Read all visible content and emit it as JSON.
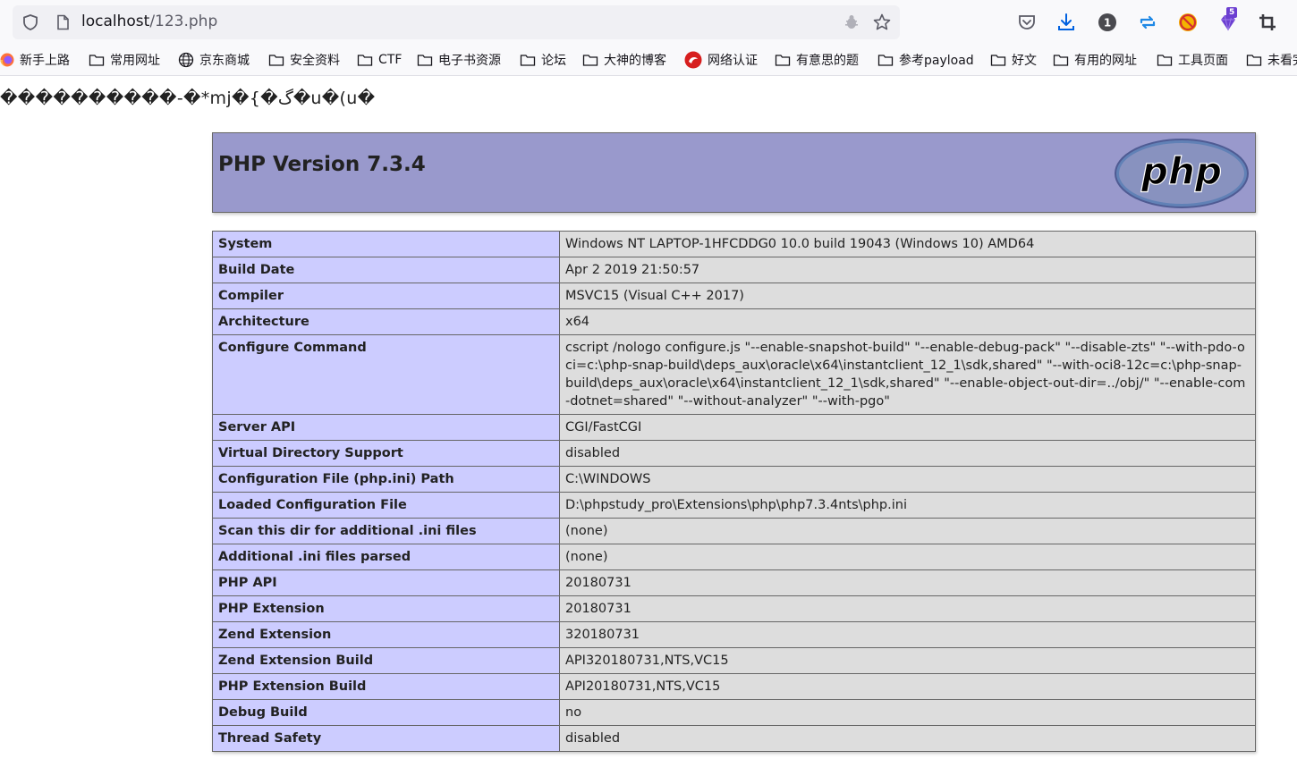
{
  "browser": {
    "url_host": "localhost",
    "url_path": "/123.php",
    "extension_badge": "5",
    "bookmarks": [
      {
        "label": "新手上路",
        "icon": "firefox-icon"
      },
      {
        "label": "常用网址",
        "icon": "folder-icon"
      },
      {
        "label": "京东商城",
        "icon": "globe-icon"
      },
      {
        "label": "安全资料",
        "icon": "folder-icon"
      },
      {
        "label": "CTF",
        "icon": "folder-icon"
      },
      {
        "label": "电子书资源",
        "icon": "folder-icon"
      },
      {
        "label": "论坛",
        "icon": "folder-icon"
      },
      {
        "label": "大神的博客",
        "icon": "folder-icon"
      },
      {
        "label": "网络认证",
        "icon": "red-logo-icon"
      },
      {
        "label": "有意思的题",
        "icon": "folder-icon"
      },
      {
        "label": "参考payload",
        "icon": "folder-icon"
      },
      {
        "label": "好文",
        "icon": "folder-icon"
      },
      {
        "label": "有用的网址",
        "icon": "folder-icon"
      },
      {
        "label": "工具页面",
        "icon": "folder-icon"
      },
      {
        "label": "未看完",
        "icon": "folder-icon"
      }
    ]
  },
  "page": {
    "garbled_text": "����������-�*mj�{�گ�u�(u�",
    "php_version_title": "PHP Version 7.3.4",
    "logo_text": "php",
    "rows": [
      {
        "key": "System",
        "value": "Windows NT LAPTOP-1HFCDDG0 10.0 build 19043 (Windows 10) AMD64"
      },
      {
        "key": "Build Date",
        "value": "Apr 2 2019 21:50:57"
      },
      {
        "key": "Compiler",
        "value": "MSVC15 (Visual C++ 2017)"
      },
      {
        "key": "Architecture",
        "value": "x64"
      },
      {
        "key": "Configure Command",
        "value": "cscript /nologo configure.js \"--enable-snapshot-build\" \"--enable-debug-pack\" \"--disable-zts\" \"--with-pdo-oci=c:\\php-snap-build\\deps_aux\\oracle\\x64\\instantclient_12_1\\sdk,shared\" \"--with-oci8-12c=c:\\php-snap-build\\deps_aux\\oracle\\x64\\instantclient_12_1\\sdk,shared\" \"--enable-object-out-dir=../obj/\" \"--enable-com-dotnet=shared\" \"--without-analyzer\" \"--with-pgo\""
      },
      {
        "key": "Server API",
        "value": "CGI/FastCGI"
      },
      {
        "key": "Virtual Directory Support",
        "value": "disabled"
      },
      {
        "key": "Configuration File (php.ini) Path",
        "value": "C:\\WINDOWS"
      },
      {
        "key": "Loaded Configuration File",
        "value": "D:\\phpstudy_pro\\Extensions\\php\\php7.3.4nts\\php.ini"
      },
      {
        "key": "Scan this dir for additional .ini files",
        "value": "(none)"
      },
      {
        "key": "Additional .ini files parsed",
        "value": "(none)"
      },
      {
        "key": "PHP API",
        "value": "20180731"
      },
      {
        "key": "PHP Extension",
        "value": "20180731"
      },
      {
        "key": "Zend Extension",
        "value": "320180731"
      },
      {
        "key": "Zend Extension Build",
        "value": "API320180731,NTS,VC15"
      },
      {
        "key": "PHP Extension Build",
        "value": "API20180731,NTS,VC15"
      },
      {
        "key": "Debug Build",
        "value": "no"
      },
      {
        "key": "Thread Safety",
        "value": "disabled"
      }
    ]
  }
}
